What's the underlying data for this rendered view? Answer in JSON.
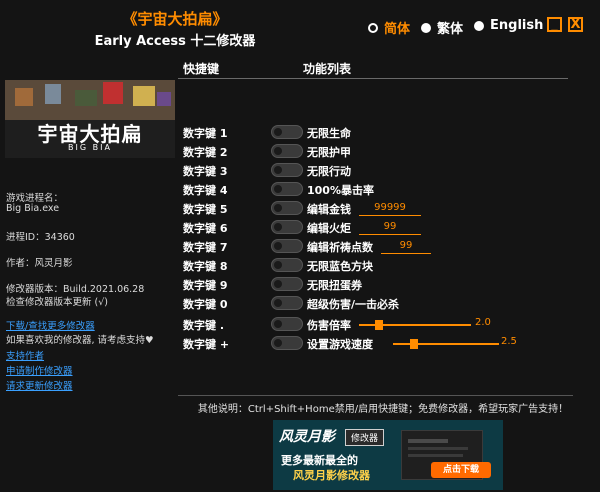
{
  "header": {
    "title": "《宇宙大拍扁》",
    "subtitle": "Early Access 十二修改器",
    "languages": [
      {
        "label": "简体",
        "active": true
      },
      {
        "label": "繁体",
        "active": false
      },
      {
        "label": "English",
        "active": false
      }
    ],
    "minimize_glyph": "_",
    "close_glyph": "X"
  },
  "banner": {
    "title": "宇宙大拍扁",
    "sub": "BIG BIA"
  },
  "info": {
    "process_label": "游戏进程名：",
    "process_name": "Big Bia.exe",
    "pid": "进程ID：34360",
    "author": "作者：风灵月影",
    "version": "修改器版本：Build.2021.06.28",
    "check_update": "检查修改器版本更新 (√)"
  },
  "links": {
    "download": "下载/查找更多修改器",
    "like_text": "如果喜欢我的修改器, 请考虑支持♥",
    "support": "支持作者",
    "request": "申请制作修改器",
    "request_update": "请求更新修改器"
  },
  "table": {
    "col_hotkey": "快捷键",
    "col_function": "功能列表",
    "rows": [
      {
        "key": "数字键 1",
        "func": "无限生命"
      },
      {
        "key": "数字键 2",
        "func": "无限护甲"
      },
      {
        "key": "数字键 3",
        "func": "无限行动"
      },
      {
        "key": "数字键 4",
        "func": "100%暴击率"
      },
      {
        "key": "数字键 5",
        "func": "编辑金钱",
        "value": "99999"
      },
      {
        "key": "数字键 6",
        "func": "编辑火炬",
        "value": "99"
      },
      {
        "key": "数字键 7",
        "func": "编辑祈祷点数",
        "value": "99"
      },
      {
        "key": "数字键 8",
        "func": "无限蓝色方块"
      },
      {
        "key": "数字键 9",
        "func": "无限扭蛋券"
      },
      {
        "key": "数字键 0",
        "func": "超级伤害/一击必杀"
      },
      {
        "key": "数字键 .",
        "func": "伤害倍率",
        "slider": "2.0",
        "slider_fraction": 0.18
      },
      {
        "key": "数字键 +",
        "func": "设置游戏速度",
        "slider": "2.5",
        "slider_fraction": 0.2
      }
    ]
  },
  "footer": {
    "text": "其他说明：Ctrl+Shift+Home禁用/启用快捷键；免费修改器，希望玩家广告支持！"
  },
  "ad": {
    "brand": "风灵月影",
    "badge": "修改器",
    "line1": "更多最新最全的",
    "line2": "风灵月影修改器",
    "button": "点击下载"
  },
  "colors": {
    "accent": "#ff8c00",
    "link": "#3aa0ff",
    "background": "#141414"
  }
}
